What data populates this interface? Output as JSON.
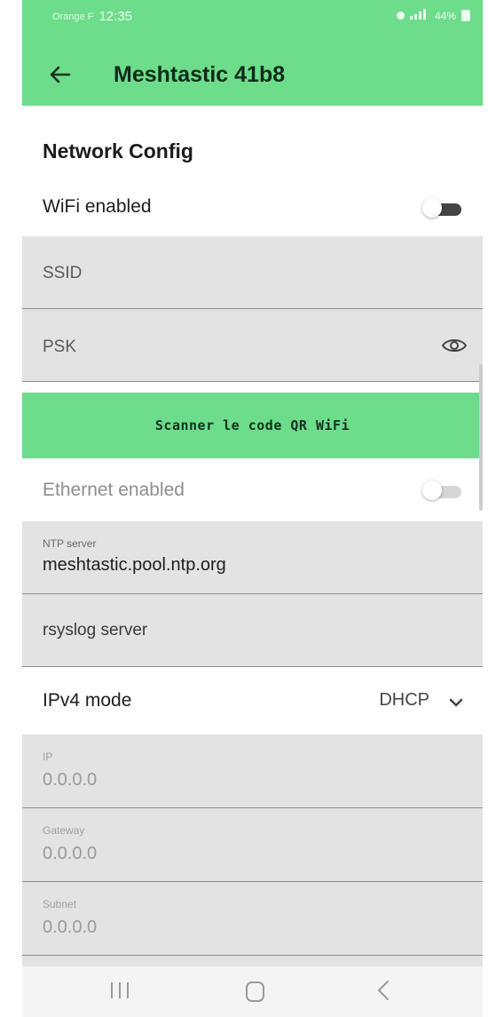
{
  "status_bar": {
    "carrier": "Orange F",
    "time": "12:35",
    "battery": "44%"
  },
  "app_bar": {
    "title": "Meshtastic 41b8"
  },
  "section": {
    "title": "Network Config"
  },
  "wifi": {
    "label": "WiFi enabled",
    "enabled": false
  },
  "ssid": {
    "label": "SSID",
    "value": ""
  },
  "psk": {
    "label": "PSK",
    "value": ""
  },
  "qr_button": {
    "label": "Scanner le code QR WiFi"
  },
  "ethernet": {
    "label": "Ethernet enabled",
    "enabled": false,
    "disabled": true
  },
  "ntp": {
    "label": "NTP server",
    "value": "meshtastic.pool.ntp.org"
  },
  "rsyslog": {
    "label": "rsyslog server",
    "value": ""
  },
  "ipv4": {
    "label": "IPv4 mode",
    "value": "DHCP"
  },
  "ip": {
    "label": "IP",
    "value": "0.0.0.0"
  },
  "gateway": {
    "label": "Gateway",
    "value": "0.0.0.0"
  },
  "subnet": {
    "label": "Subnet",
    "value": "0.0.0.0"
  },
  "icons": {
    "back": "back-arrow-icon",
    "psk_toggle": "eye-icon",
    "dropdown": "chevron-down-icon",
    "nav_recents": "recents-icon",
    "nav_home": "home-icon",
    "nav_back": "nav-back-icon"
  },
  "colors": {
    "accent": "#6ddc8b",
    "field_background": "#e3e3e3"
  }
}
